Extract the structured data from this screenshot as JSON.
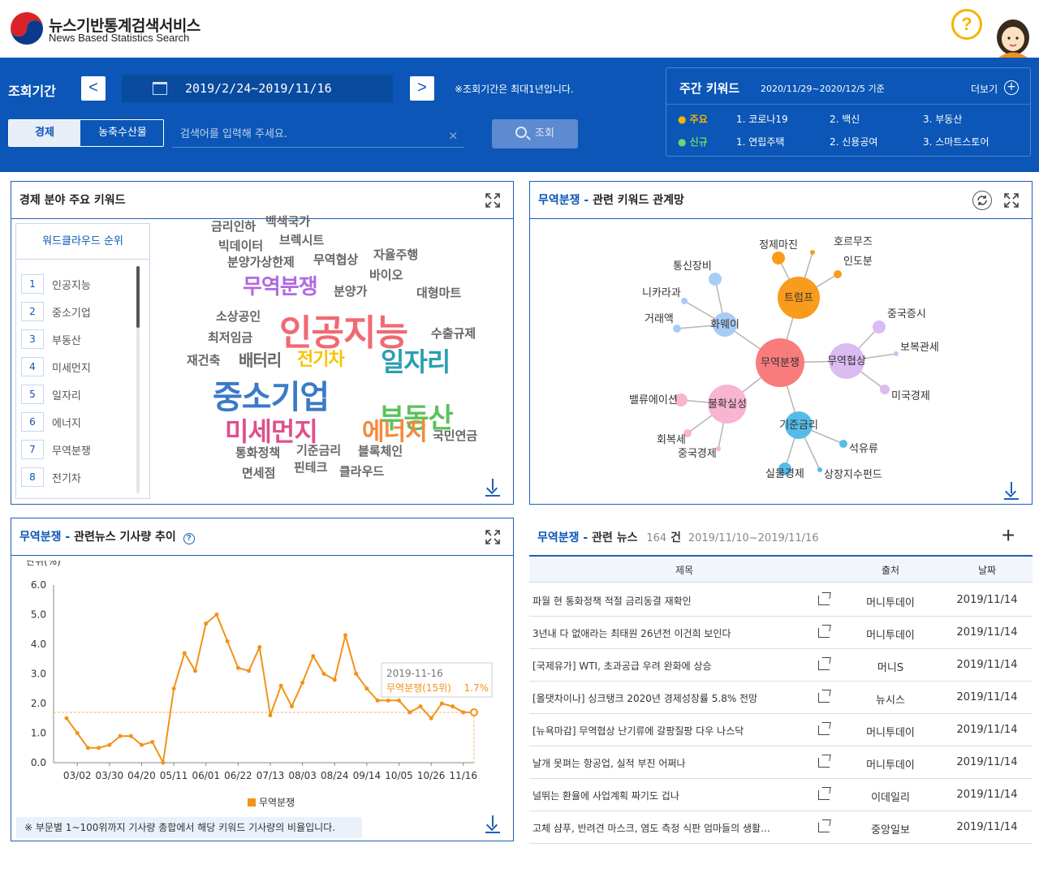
{
  "header": {
    "site_title": "뉴스기반통계검색서비스",
    "site_subtitle": "News Based Statistics Search",
    "help_icon": "?"
  },
  "search": {
    "period_label": "조회기간",
    "prev": "<",
    "next": ">",
    "date_range": "2019/2/24~2019/11/16",
    "period_note": "※조회기간은 최대1년입니다.",
    "tabs": [
      "경제",
      "농축수산물"
    ],
    "input_placeholder": "검색어를 입력해 주세요.",
    "clear": "×",
    "query_button": "조회"
  },
  "weekly": {
    "title": "주간 키워드",
    "range": "2020/11/29~2020/12/5 기준",
    "more": "더보기",
    "plus": "+",
    "main_label": "주요",
    "new_label": "신규",
    "main": [
      "1. 코로나19",
      "2. 백신",
      "3. 부동산"
    ],
    "new": [
      "1. 연립주택",
      "2. 신용공여",
      "3. 스마트스토어"
    ],
    "main_color": "#f5b400",
    "new_color": "#6fd36f"
  },
  "keywords_panel": {
    "title": "경제 분야 주요 키워드",
    "rank_title": "워드클라우드 순위",
    "ranks": [
      {
        "num": "1",
        "label": "인공지능"
      },
      {
        "num": "2",
        "label": "중소기업"
      },
      {
        "num": "3",
        "label": "부동산"
      },
      {
        "num": "4",
        "label": "미세먼지"
      },
      {
        "num": "5",
        "label": "일자리"
      },
      {
        "num": "6",
        "label": "에너지"
      },
      {
        "num": "7",
        "label": "무역분쟁"
      },
      {
        "num": "8",
        "label": "전기차"
      }
    ],
    "cloud": [
      {
        "text": "인공지능",
        "color": "#f06a72"
      },
      {
        "text": "중소기업",
        "color": "#3a7ac8"
      },
      {
        "text": "부동산",
        "color": "#5cc15c"
      },
      {
        "text": "미세먼지",
        "color": "#e0508a"
      },
      {
        "text": "일자리",
        "color": "#2b9fb0"
      },
      {
        "text": "에너지",
        "color": "#f5893a"
      },
      {
        "text": "무역분쟁",
        "color": "#b06ae0"
      },
      {
        "text": "전기차",
        "color": "#f5c400"
      },
      {
        "text": "배터리",
        "color": "#666"
      },
      {
        "text": "금리인하",
        "color": "#666"
      },
      {
        "text": "백색국가",
        "color": "#666"
      },
      {
        "text": "빅데이터",
        "color": "#666"
      },
      {
        "text": "브렉시트",
        "color": "#666"
      },
      {
        "text": "분양가상한제",
        "color": "#666"
      },
      {
        "text": "무역협상",
        "color": "#666"
      },
      {
        "text": "자율주행",
        "color": "#666"
      },
      {
        "text": "바이오",
        "color": "#666"
      },
      {
        "text": "분양가",
        "color": "#666"
      },
      {
        "text": "대형마트",
        "color": "#666"
      },
      {
        "text": "소상공인",
        "color": "#666"
      },
      {
        "text": "최저임금",
        "color": "#666"
      },
      {
        "text": "수출규제",
        "color": "#666"
      },
      {
        "text": "재건축",
        "color": "#666"
      },
      {
        "text": "국민연금",
        "color": "#666"
      },
      {
        "text": "통화정책",
        "color": "#666"
      },
      {
        "text": "기준금리",
        "color": "#666"
      },
      {
        "text": "블록체인",
        "color": "#666"
      },
      {
        "text": "면세점",
        "color": "#666"
      },
      {
        "text": "핀테크",
        "color": "#666"
      },
      {
        "text": "클라우드",
        "color": "#666"
      }
    ]
  },
  "network_panel": {
    "title_kw": "무역분쟁 -",
    "title_rest": "관련 키워드 관계망",
    "nodes": [
      "무역분쟁",
      "트럼프",
      "화웨이",
      "무역협상",
      "불확실성",
      "기준금리",
      "정제마진",
      "호르무즈",
      "인도분",
      "통신장비",
      "니카라과",
      "거래액",
      "중국증시",
      "보복관세",
      "미국경제",
      "밸류에이션",
      "회복세",
      "중국경제",
      "석유류",
      "실물경제",
      "상장지수펀드"
    ]
  },
  "trend_panel": {
    "title_kw": "무역분쟁 -",
    "title_rest": "관련뉴스 기사량 추이",
    "note": "※ 부문별 1~100위까지 기사량 총합에서 해당 키워드 기사량의 비율입니다.",
    "tooltip_date": "2019-11-16",
    "tooltip_series": "무역분쟁(15위)",
    "tooltip_value": "1.7%"
  },
  "chart_data": {
    "type": "line",
    "title": "",
    "ylabel": "단위(%)",
    "xlabel": "",
    "ylim": [
      0,
      6
    ],
    "yticks": [
      "6.0",
      "5.0",
      "4.0",
      "3.0",
      "2.0",
      "1.0",
      "0.0"
    ],
    "xticks": [
      "03/02",
      "03/30",
      "04/20",
      "05/11",
      "06/01",
      "06/22",
      "07/13",
      "08/03",
      "08/24",
      "09/14",
      "10/05",
      "10/26",
      "11/16"
    ],
    "legend": "bottom",
    "series": [
      {
        "name": "무역분쟁",
        "color": "#f29219",
        "x": [
          "02/24",
          "03/02",
          "03/09",
          "03/16",
          "03/23",
          "03/30",
          "04/06",
          "04/13",
          "04/20",
          "04/27",
          "05/04",
          "05/11",
          "05/18",
          "05/25",
          "06/01",
          "06/08",
          "06/15",
          "06/22",
          "06/29",
          "07/06",
          "07/13",
          "07/20",
          "07/27",
          "08/03",
          "08/10",
          "08/17",
          "08/24",
          "08/31",
          "09/07",
          "09/14",
          "09/21",
          "09/28",
          "10/05",
          "10/12",
          "10/19",
          "10/26",
          "11/02",
          "11/09",
          "11/16"
        ],
        "values": [
          1.5,
          1.0,
          0.5,
          0.5,
          0.6,
          0.9,
          0.9,
          0.6,
          0.7,
          0.0,
          2.5,
          3.7,
          3.1,
          4.7,
          5.0,
          4.1,
          3.2,
          3.1,
          3.9,
          1.6,
          2.6,
          1.9,
          2.7,
          3.6,
          3.0,
          2.8,
          4.3,
          3.0,
          2.5,
          2.1,
          2.1,
          2.1,
          1.7,
          1.9,
          1.5,
          2.0,
          1.9,
          1.7,
          1.7
        ]
      }
    ]
  },
  "news_panel": {
    "title_kw": "무역분쟁 -",
    "title_rest": "관련 뉴스",
    "count": "164",
    "count_unit": "건",
    "range": "2019/11/10~2019/11/16",
    "plus": "+",
    "headers": [
      "제목",
      "출처",
      "날짜"
    ],
    "rows": [
      {
        "title": "파월 현 통화정책 적절 금리동결 재확인",
        "source": "머니투데이",
        "date": "2019/11/14"
      },
      {
        "title": "3년내 다 없애라는 최태원 26년전 이건희 보인다",
        "source": "머니투데이",
        "date": "2019/11/14"
      },
      {
        "title": "[국제유가] WTI, 초과공급 우려 완화에 상승",
        "source": "머니S",
        "date": "2019/11/14"
      },
      {
        "title": "[올댓차이나] 싱크탱크 2020년 경제성장률 5.8% 전망",
        "source": "뉴시스",
        "date": "2019/11/14"
      },
      {
        "title": "[뉴욕마감] 무역협상 난기류에 갈팡질팡 다우 나스닥",
        "source": "머니투데이",
        "date": "2019/11/14"
      },
      {
        "title": "날개 못펴는 항공업, 실적 부진 어쩌나",
        "source": "머니투데이",
        "date": "2019/11/14"
      },
      {
        "title": "널뛰는 환율에 사업계획 짜기도 겁나",
        "source": "이데일리",
        "date": "2019/11/14"
      },
      {
        "title": "고체 샴푸, 반려견 마스크, 염도 측정 식판 엄마들의 생활…",
        "source": "중앙일보",
        "date": "2019/11/14"
      }
    ]
  }
}
